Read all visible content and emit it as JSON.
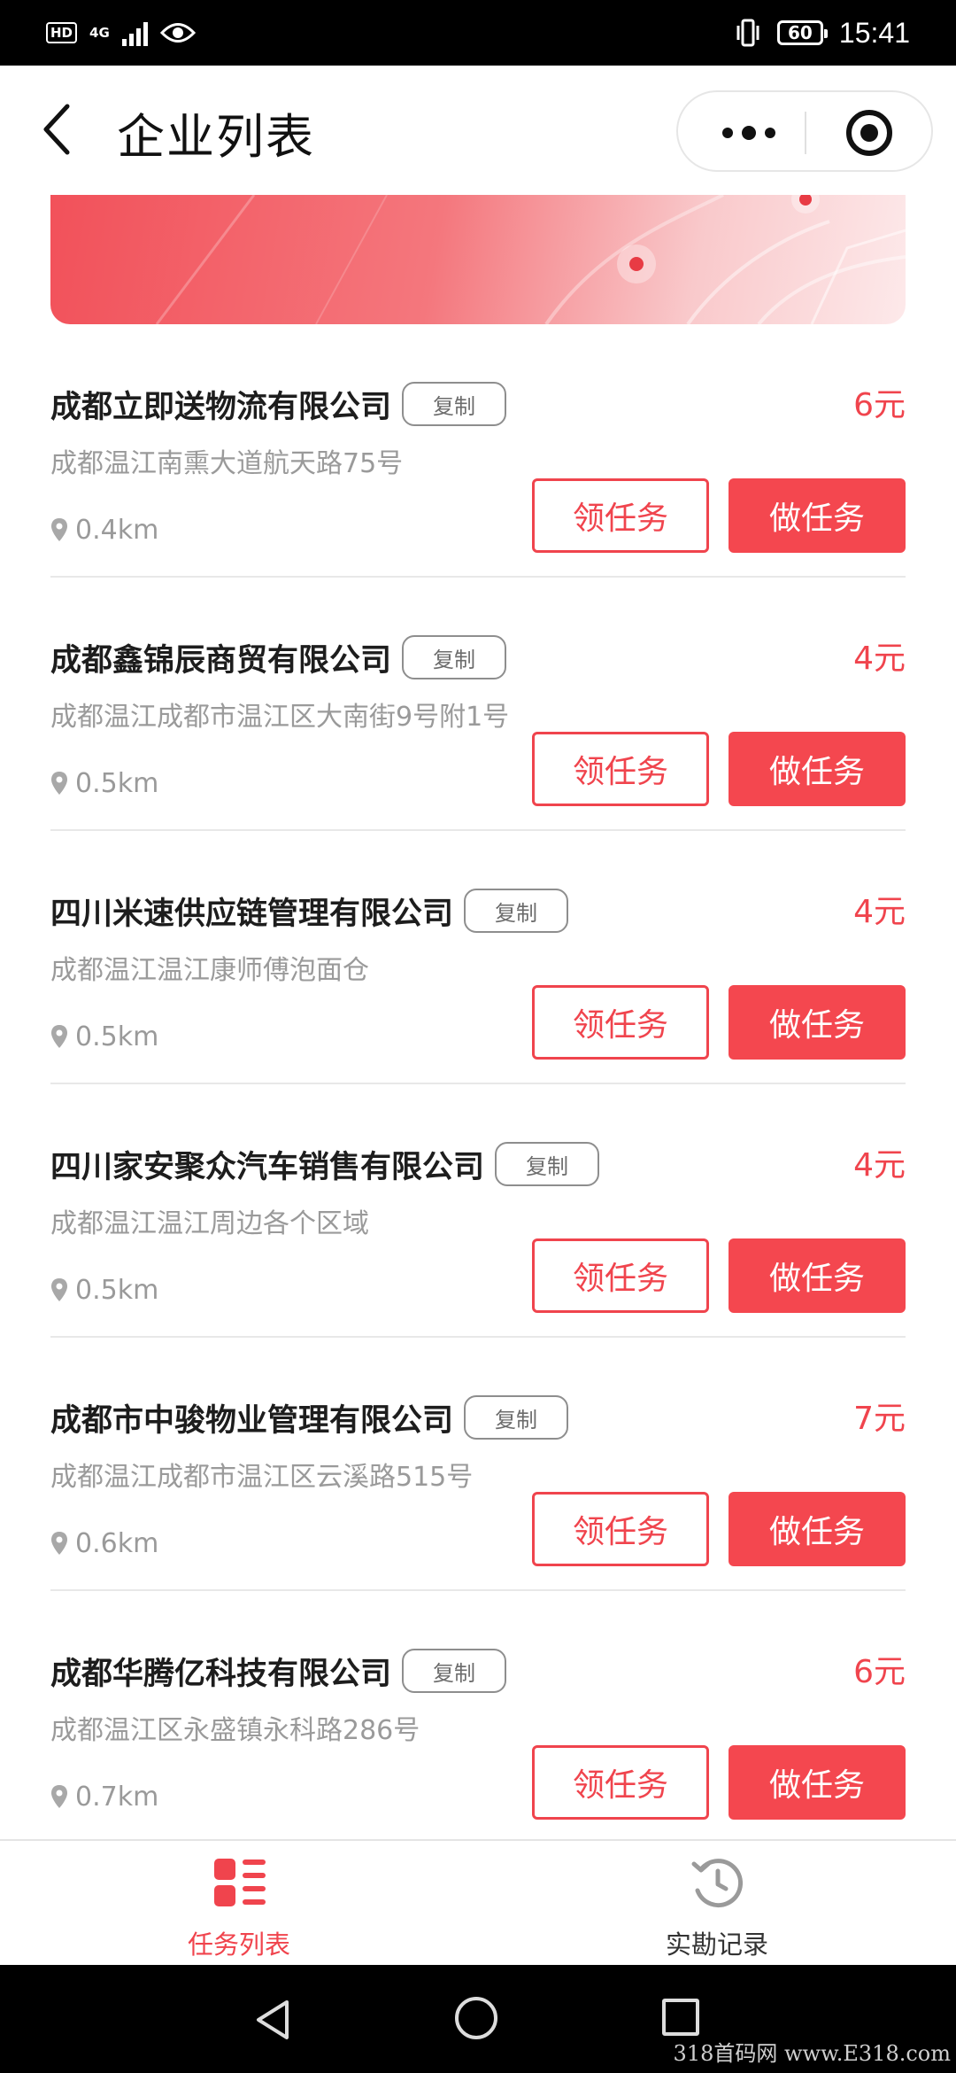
{
  "status_bar": {
    "hd": "HD",
    "network": "4G",
    "battery": "60",
    "time": "15:41"
  },
  "header": {
    "title": "企业列表"
  },
  "companies": [
    {
      "name": "成都立即送物流有限公司",
      "copy_label": "复制",
      "price": "6元",
      "address": "成都温江南熏大道航天路75号",
      "distance": "0.4km",
      "claim_label": "领任务",
      "do_label": "做任务"
    },
    {
      "name": "成都鑫锦辰商贸有限公司",
      "copy_label": "复制",
      "price": "4元",
      "address": "成都温江成都市温江区大南街9号附1号",
      "distance": "0.5km",
      "claim_label": "领任务",
      "do_label": "做任务"
    },
    {
      "name": "四川米速供应链管理有限公司",
      "copy_label": "复制",
      "price": "4元",
      "address": "成都温江温江康师傅泡面仓",
      "distance": "0.5km",
      "claim_label": "领任务",
      "do_label": "做任务"
    },
    {
      "name": "四川家安聚众汽车销售有限公司",
      "copy_label": "复制",
      "price": "4元",
      "address": "成都温江温江周边各个区域",
      "distance": "0.5km",
      "claim_label": "领任务",
      "do_label": "做任务"
    },
    {
      "name": "成都市中骏物业管理有限公司",
      "copy_label": "复制",
      "price": "7元",
      "address": "成都温江成都市温江区云溪路515号",
      "distance": "0.6km",
      "claim_label": "领任务",
      "do_label": "做任务"
    },
    {
      "name": "成都华腾亿科技有限公司",
      "copy_label": "复制",
      "price": "6元",
      "address": "成都温江区永盛镇永科路286号",
      "distance": "0.7km",
      "claim_label": "领任务",
      "do_label": "做任务"
    }
  ],
  "tabbar": {
    "tabs": [
      {
        "label": "任务列表",
        "icon": "list-icon",
        "active": true
      },
      {
        "label": "实勘记录",
        "icon": "history-icon",
        "active": false
      }
    ]
  },
  "watermark": "318首码网 www.E318.com",
  "colors": {
    "accent": "#f0444d",
    "secondary_text": "#9a9a9a"
  }
}
